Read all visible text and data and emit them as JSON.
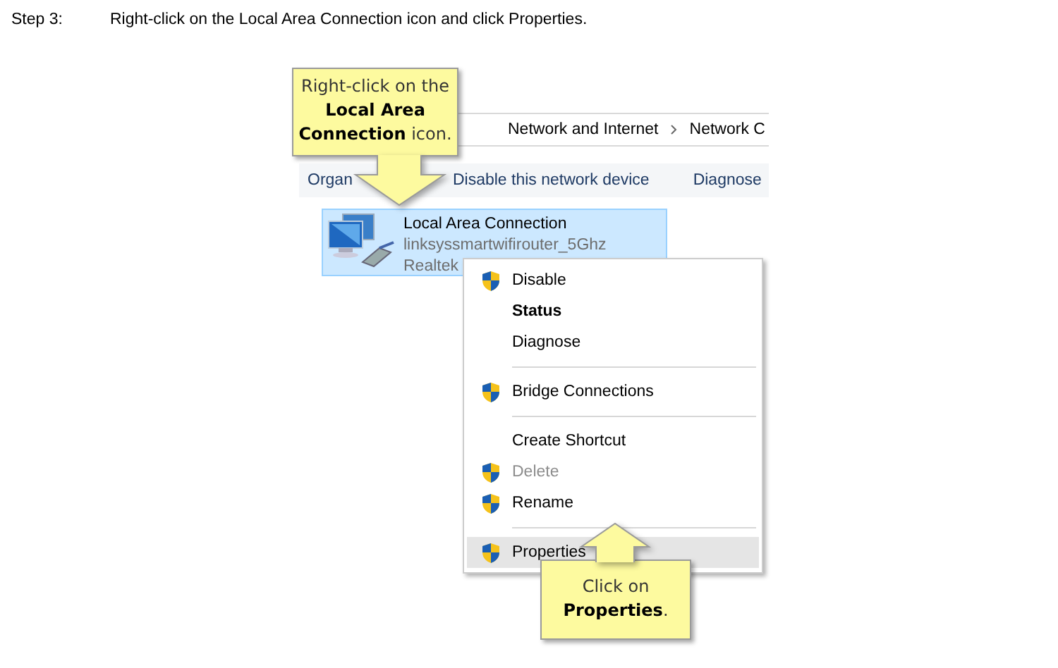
{
  "step": {
    "label": "Step 3:",
    "text": "Right-click on the Local Area Connection icon and click Properties."
  },
  "screenshot": {
    "breadcrumb": [
      "Network and Internet",
      "Network C"
    ],
    "toolbar": [
      "Organ",
      "Disable this network device",
      "Diagnose"
    ],
    "item": {
      "title": "Local Area Connection",
      "lines": [
        "linksyssmartwifirouter_5Ghz",
        "Realtek"
      ],
      "selected": true
    },
    "context_menu": {
      "groups": [
        [
          {
            "label": "Disable",
            "shield": true,
            "default": false,
            "disabled": false,
            "selected": false
          },
          {
            "label": "Status",
            "shield": false,
            "default": true,
            "disabled": false,
            "selected": false
          },
          {
            "label": "Diagnose",
            "shield": false,
            "default": false,
            "disabled": false,
            "selected": false
          }
        ],
        [
          {
            "label": "Bridge Connections",
            "shield": true,
            "default": false,
            "disabled": false,
            "selected": false
          }
        ],
        [
          {
            "label": "Create Shortcut",
            "shield": false,
            "default": false,
            "disabled": false,
            "selected": false
          },
          {
            "label": "Delete",
            "shield": true,
            "default": false,
            "disabled": true,
            "selected": false
          },
          {
            "label": "Rename",
            "shield": true,
            "default": false,
            "disabled": false,
            "selected": false
          }
        ],
        [
          {
            "label": "Properties",
            "shield": true,
            "default": false,
            "disabled": false,
            "selected": true
          }
        ]
      ]
    }
  },
  "callouts": [
    {
      "text": "Right-click on the **Local Area Connection** icon.",
      "kind": "down"
    },
    {
      "text": "Click on **Properties**.",
      "kind": "up"
    }
  ]
}
